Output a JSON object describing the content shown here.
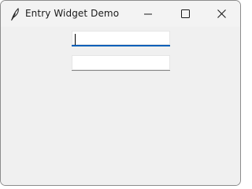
{
  "window": {
    "title": "Entry Widget Demo",
    "icon": "feather-icon",
    "controls": [
      "minimize-icon",
      "maximize-icon",
      "close-icon"
    ]
  },
  "entries": [
    {
      "value": "",
      "focused": true
    },
    {
      "value": "",
      "focused": false
    }
  ],
  "colors": {
    "focus_accent": "#005fb8",
    "background": "#f0f0f0"
  }
}
